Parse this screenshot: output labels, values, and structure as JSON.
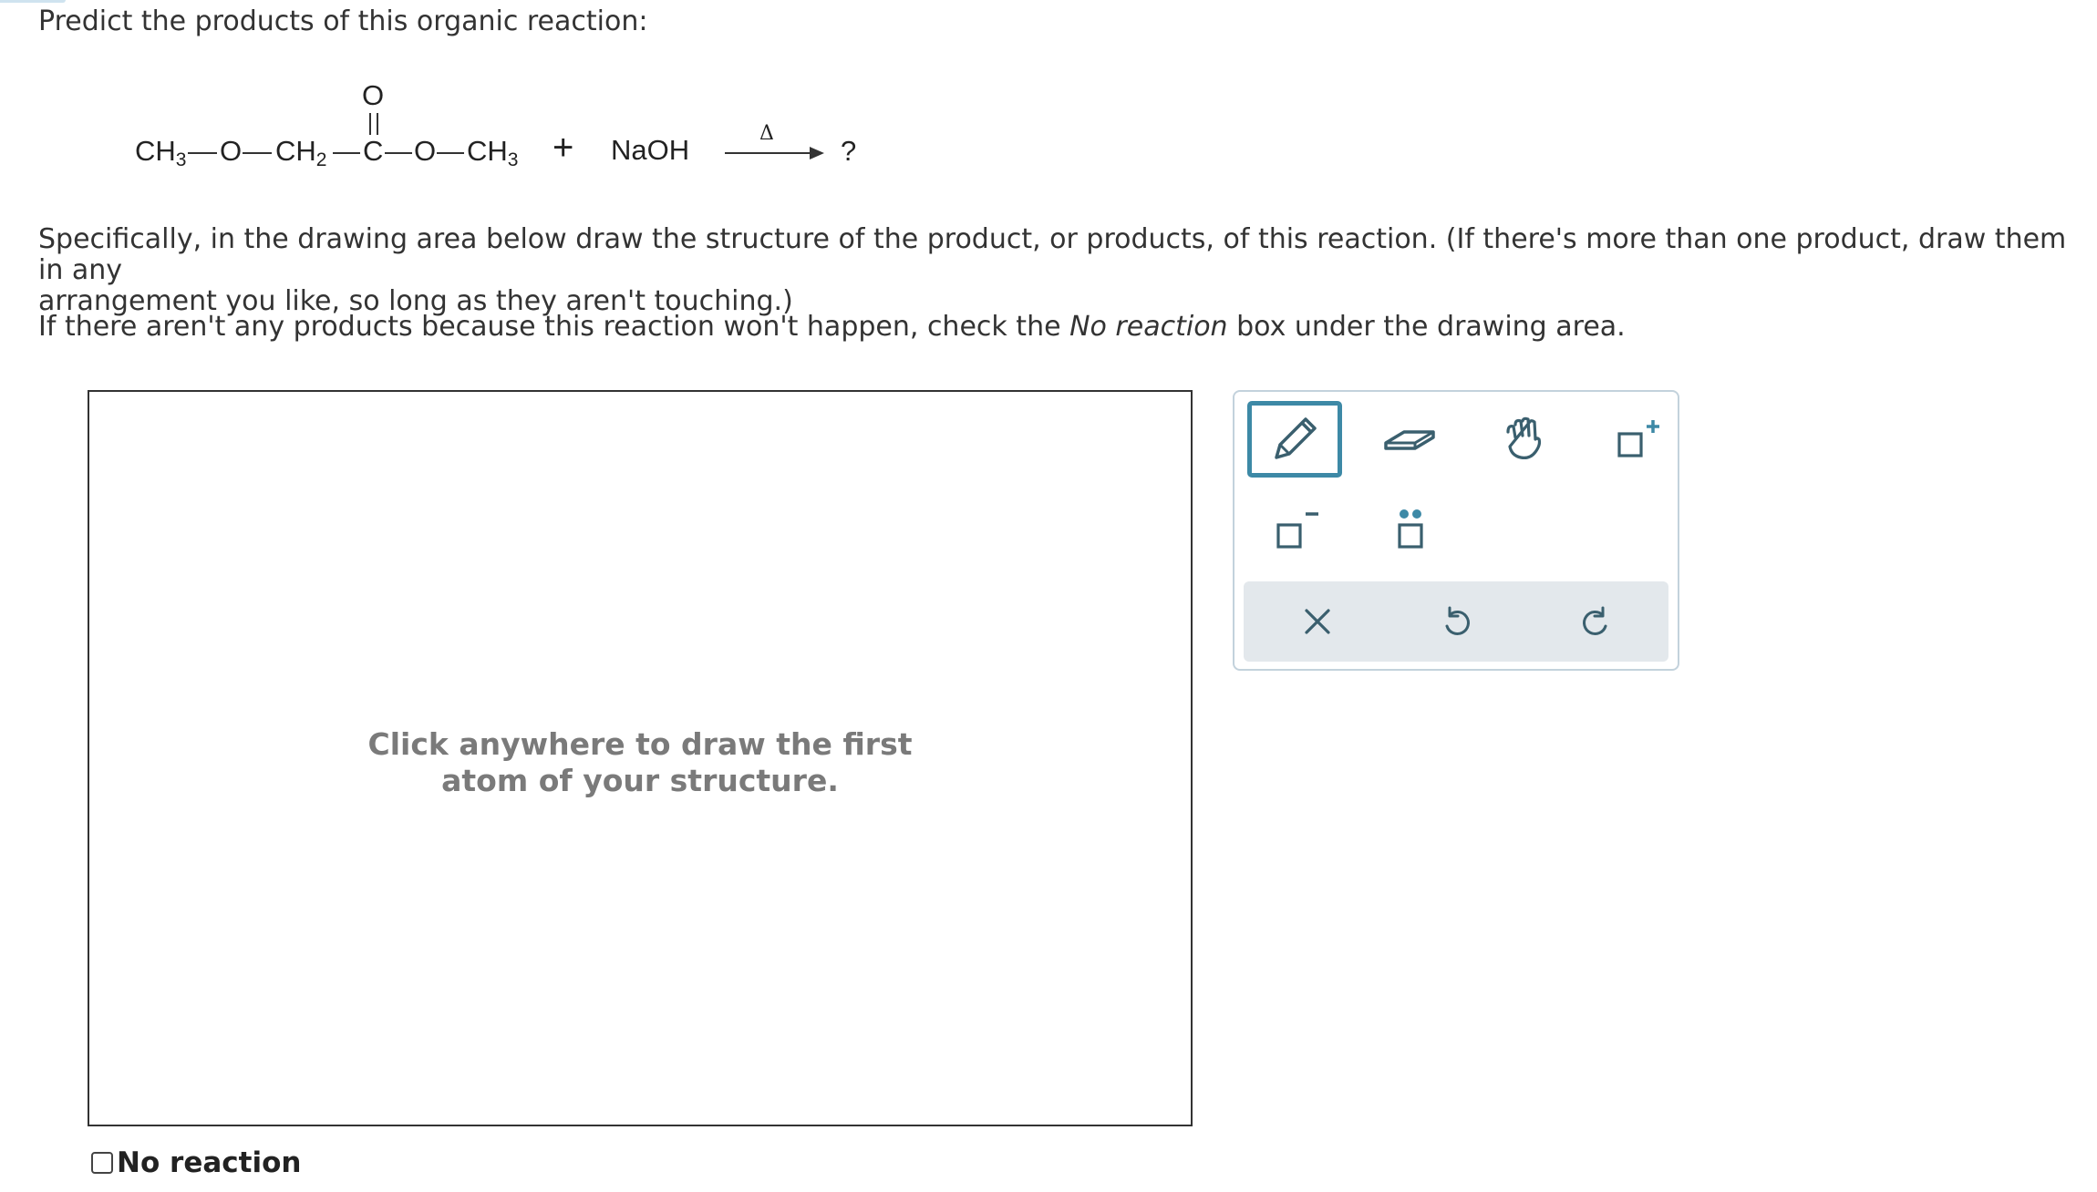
{
  "question": {
    "prompt": "Predict the products of this organic reaction:",
    "instruction_line1": "Specifically, in the drawing area below draw the structure of the product, or products, of this reaction. (If there's more than one product, draw them in any",
    "instruction_line2": "arrangement you like, so long as they aren't touching.)",
    "noreaction_pre": "If there aren't any products because this reaction won't happen, check the ",
    "noreaction_em": "No reaction",
    "noreaction_post": " box under the drawing area."
  },
  "reaction": {
    "ch3_left": "CH",
    "ch3_left_sub": "3",
    "o1": "O",
    "ch2": "CH",
    "ch2_sub": "2",
    "carbonyl_o": "O",
    "c": "C",
    "o2": "O",
    "ch3_right": "CH",
    "ch3_right_sub": "3",
    "plus": "+",
    "reagent": "NaOH",
    "condition": "Δ",
    "product": "?"
  },
  "drawing_area": {
    "hint_line1": "Click anywhere to draw the first",
    "hint_line2": "atom of your structure."
  },
  "no_reaction": {
    "label": "No reaction",
    "checked": false
  },
  "toolbox": {
    "tools": [
      "pencil-icon",
      "eraser-icon",
      "hand-icon",
      "positive-charge-icon",
      "negative-charge-icon",
      "lone-pair-icon"
    ],
    "actions": [
      "clear-icon",
      "undo-icon",
      "redo-icon"
    ],
    "accent_color": "#3d89a6",
    "icon_color": "#3a5f6e"
  }
}
